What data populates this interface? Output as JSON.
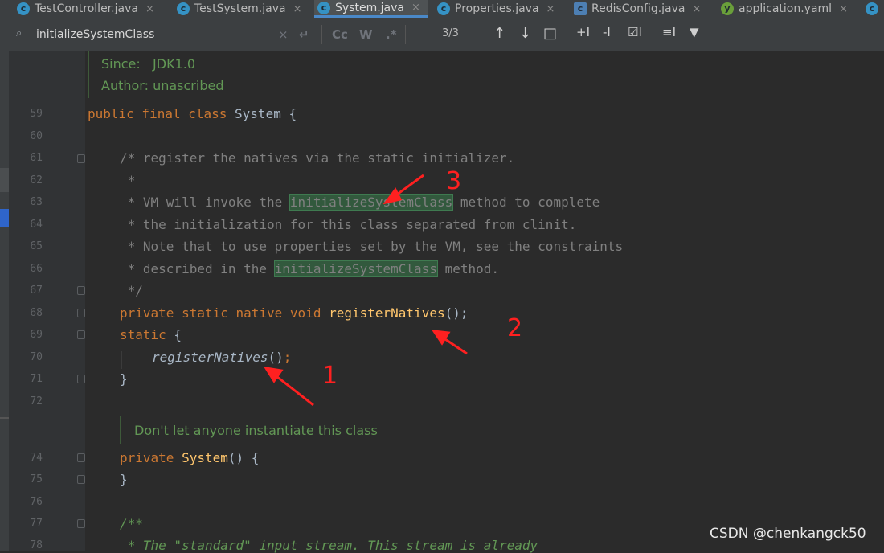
{
  "tabs": [
    {
      "label": "TestController.java",
      "icon": "c",
      "active": false
    },
    {
      "label": "TestSystem.java",
      "icon": "c",
      "active": false
    },
    {
      "label": "System.java",
      "icon": "c",
      "active": true
    },
    {
      "label": "Properties.java",
      "icon": "c",
      "active": false
    },
    {
      "label": "RedisConfig.java",
      "icon": "cfg",
      "active": false
    },
    {
      "label": "application.yaml",
      "icon": "yml",
      "active": false
    }
  ],
  "tab_close_glyph": "×",
  "find": {
    "query": "initializeSystemClass",
    "clear_glyph": "×",
    "replace_glyph": "↵",
    "match_case": "Cc",
    "words": "W",
    "regex": ".*",
    "match_count": "3/3",
    "prev_glyph": "↑",
    "next_glyph": "↓",
    "select_all_glyph": "□",
    "add_selection_glyph": "+I",
    "remove_selection_glyph": "-I",
    "select_all_occ_glyph": "☑I",
    "context_glyph": "≡I",
    "filter_glyph": "▼"
  },
  "doc_header": {
    "since_label": "Since:",
    "since_value": "JDK1.0",
    "author_label": "Author:",
    "author_value": "unascribed"
  },
  "lines": {
    "l59": "59",
    "l60": "60",
    "l61": "61",
    "l62": "62",
    "l63": "63",
    "l64": "64",
    "l65": "65",
    "l66": "66",
    "l67": "67",
    "l68": "68",
    "l69": "69",
    "l70": "70",
    "l71": "71",
    "l72": "72",
    "l74": "74",
    "l75": "75",
    "l76": "76",
    "l77": "77",
    "l78": "78"
  },
  "code": {
    "c59_kw": "public final class ",
    "c59_rest": "System {",
    "c61": "/* register the natives via the static initializer.",
    "c62": " *",
    "c63_a": " * VM will invoke the ",
    "c63_hl": "initializeSystemClass",
    "c63_b": " method to complete",
    "c64": " * the initialization for this class separated from clinit.",
    "c65": " * Note that to use properties set by the VM, see the constraints",
    "c66_a": " * described in the ",
    "c66_hl": "initializeSystemClass",
    "c66_b": " method.",
    "c67": " */",
    "c68_kw": "private static native void ",
    "c68_fn": "registerNatives",
    "c68_rest": "();",
    "c69_kw": "static",
    "c69_rest": " {",
    "c70_fn": "registerNatives",
    "c70_rest": "()",
    "c70_semi": ";",
    "c71": "}",
    "doc73": "Don't let anyone instantiate this class",
    "c74_kw": "private ",
    "c74_fn": "System",
    "c74_rest": "() {",
    "c75": "}",
    "c77": "/**",
    "c78": " * The \"standard\" input stream. This stream is already"
  },
  "annotations": {
    "n1": "1",
    "n2": "2",
    "n3": "3",
    "color": "#ff2020"
  },
  "watermark": "CSDN @chenkangck50"
}
